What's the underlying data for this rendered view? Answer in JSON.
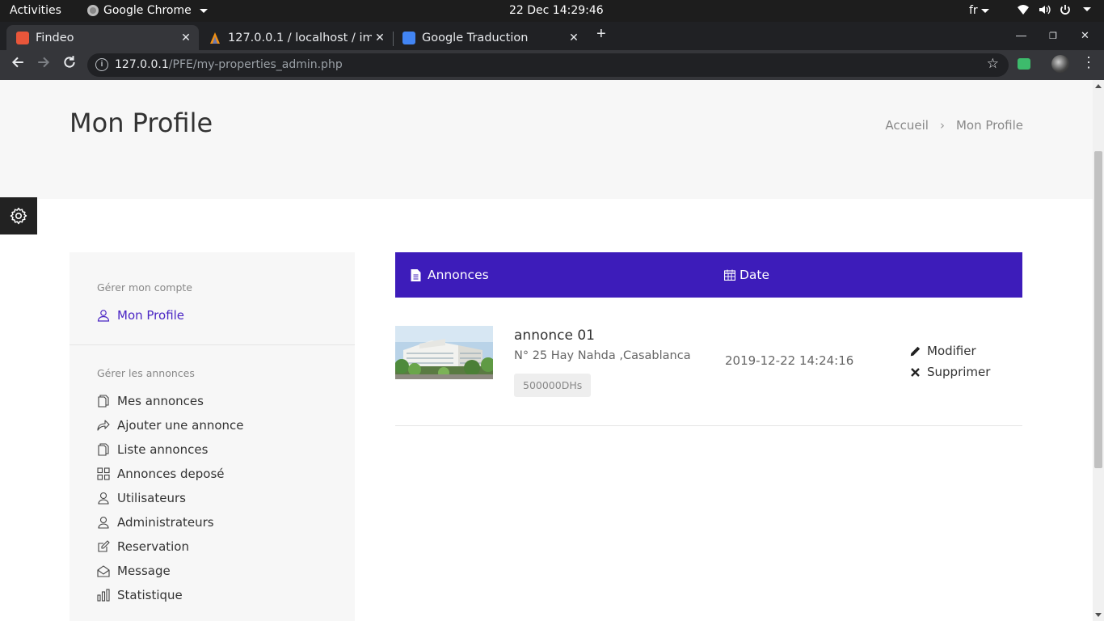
{
  "os": {
    "activities": "Activities",
    "app_name": "Google Chrome",
    "clock": "22 Dec  14:29:46",
    "lang": "fr"
  },
  "tabs": [
    {
      "title": "Findeo",
      "favicon_color": "#e8563a"
    },
    {
      "title": "127.0.0.1 / localhost / imm",
      "favicon_color": "#f29111"
    },
    {
      "title": "Google Traduction",
      "favicon_color": "#4285f4"
    }
  ],
  "address": {
    "host": "127.0.0.1",
    "path": "/PFE/my-properties_admin.php"
  },
  "header": {
    "title": "Mon Profile",
    "breadcrumb": [
      "Accueil",
      "Mon Profile"
    ]
  },
  "sidebar": {
    "section1_title": "Gérer mon compte",
    "profile_link": "Mon Profile",
    "section2_title": "Gérer les annonces",
    "items": [
      {
        "label": "Mes annonces",
        "icon": "copy-icon"
      },
      {
        "label": "Ajouter une annonce",
        "icon": "share-icon"
      },
      {
        "label": "Liste annonces",
        "icon": "copy-icon"
      },
      {
        "label": "Annonces deposé",
        "icon": "grid-icon"
      },
      {
        "label": "Utilisateurs",
        "icon": "user-icon"
      },
      {
        "label": "Administrateurs",
        "icon": "user-icon"
      },
      {
        "label": "Reservation",
        "icon": "edit-icon"
      },
      {
        "label": "Message",
        "icon": "envelope-icon"
      },
      {
        "label": "Statistique",
        "icon": "chart-icon"
      }
    ]
  },
  "table": {
    "col_annonces": "Annonces",
    "col_date": "Date",
    "rows": [
      {
        "title": "annonce 01",
        "address": "N° 25 Hay Nahda ,Casablanca",
        "price": "500000DHs",
        "date": "2019-12-22 14:24:16",
        "actions": [
          "Modifier",
          "Supprimer"
        ]
      }
    ]
  },
  "colors": {
    "accent": "#3d1cba",
    "link": "#4a25c4"
  }
}
